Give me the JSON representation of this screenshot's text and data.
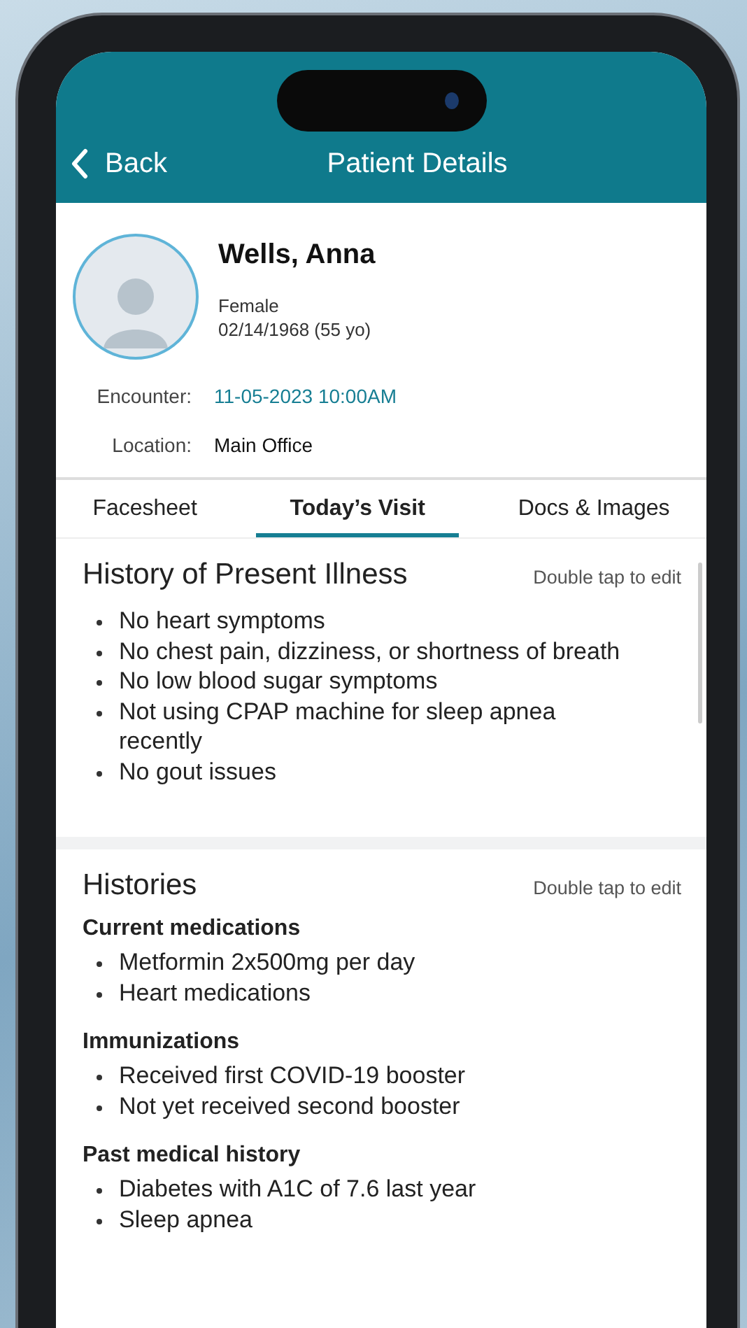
{
  "nav": {
    "back": "Back",
    "title": "Patient Details"
  },
  "patient": {
    "name": "Wells, Anna",
    "sex": "Female",
    "birth": "02/14/1968 (55 yo)"
  },
  "fields": [
    {
      "label": "Encounter:",
      "value": "11-05-2023 10:00AM",
      "kind": "link"
    },
    {
      "label": "Location:",
      "value": "Main Office",
      "kind": "plain"
    }
  ],
  "tabs": [
    {
      "label": "Facesheet",
      "selected": false
    },
    {
      "label": "Today’s Visit",
      "selected": true
    },
    {
      "label": "Docs & Images",
      "selected": false
    }
  ],
  "sections": [
    {
      "title": "History of Present Illness",
      "hint": "Double tap to edit",
      "groups": [
        {
          "items": [
            "No heart symptoms",
            "No chest pain, dizziness, or shortness of breath",
            "No low blood sugar symptoms",
            "Not using CPAP machine for sleep apnea recently",
            "No gout issues"
          ]
        }
      ]
    },
    {
      "title": "Histories",
      "hint": "Double tap to edit",
      "groups": [
        {
          "heading": "Current medications",
          "items": [
            "Metformin 2x500mg per day",
            "Heart medications"
          ]
        },
        {
          "heading": "Immunizations",
          "items": [
            "Received first COVID-19 booster",
            "Not yet received second booster"
          ]
        },
        {
          "heading": "Past medical history",
          "items": [
            "Diabetes with A1C of 7.6 last year",
            "Sleep apnea"
          ]
        }
      ]
    }
  ]
}
